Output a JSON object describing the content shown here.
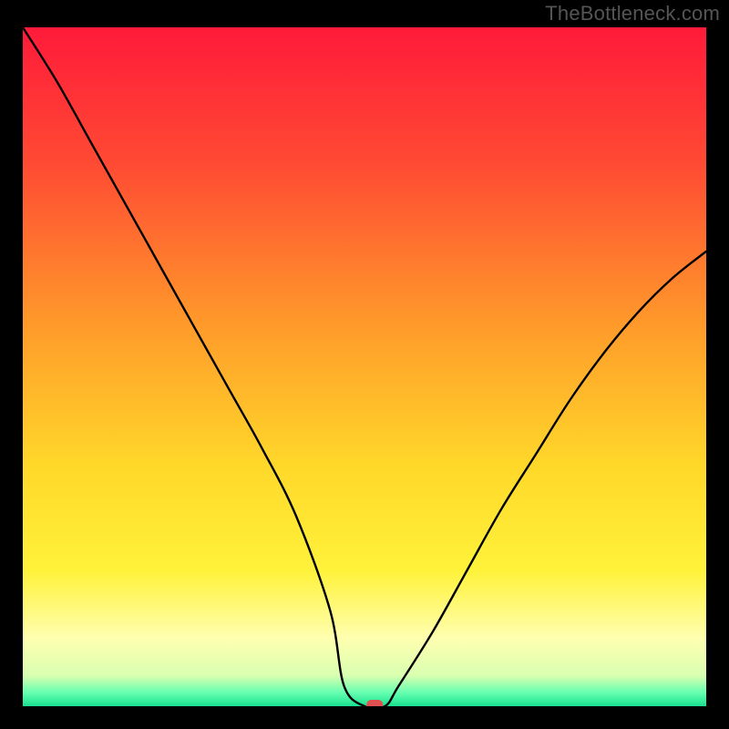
{
  "watermark": "TheBottleneck.com",
  "chart_data": {
    "type": "line",
    "title": "",
    "xlabel": "",
    "ylabel": "",
    "xlim": [
      0,
      100
    ],
    "ylim": [
      0,
      100
    ],
    "x": [
      0,
      5,
      10,
      15,
      20,
      25,
      30,
      35,
      40,
      45,
      47,
      50,
      53,
      55,
      60,
      65,
      70,
      75,
      80,
      85,
      90,
      95,
      100
    ],
    "values": [
      100,
      92,
      83,
      74,
      65,
      56,
      47,
      38,
      28,
      14,
      3,
      0,
      0,
      3,
      11,
      20,
      29,
      37,
      45,
      52,
      58,
      63,
      67
    ],
    "background_gradient": {
      "stops": [
        {
          "offset": 0.0,
          "color": "#ff1a3a"
        },
        {
          "offset": 0.2,
          "color": "#ff4a33"
        },
        {
          "offset": 0.45,
          "color": "#ff9e2a"
        },
        {
          "offset": 0.65,
          "color": "#ffd92a"
        },
        {
          "offset": 0.8,
          "color": "#fff23a"
        },
        {
          "offset": 0.9,
          "color": "#ffffb0"
        },
        {
          "offset": 0.955,
          "color": "#d9ffb0"
        },
        {
          "offset": 0.98,
          "color": "#66ffb0"
        },
        {
          "offset": 1.0,
          "color": "#18e090"
        }
      ]
    },
    "marker": {
      "x": 51.5,
      "y": 0,
      "color": "#e05050"
    }
  }
}
